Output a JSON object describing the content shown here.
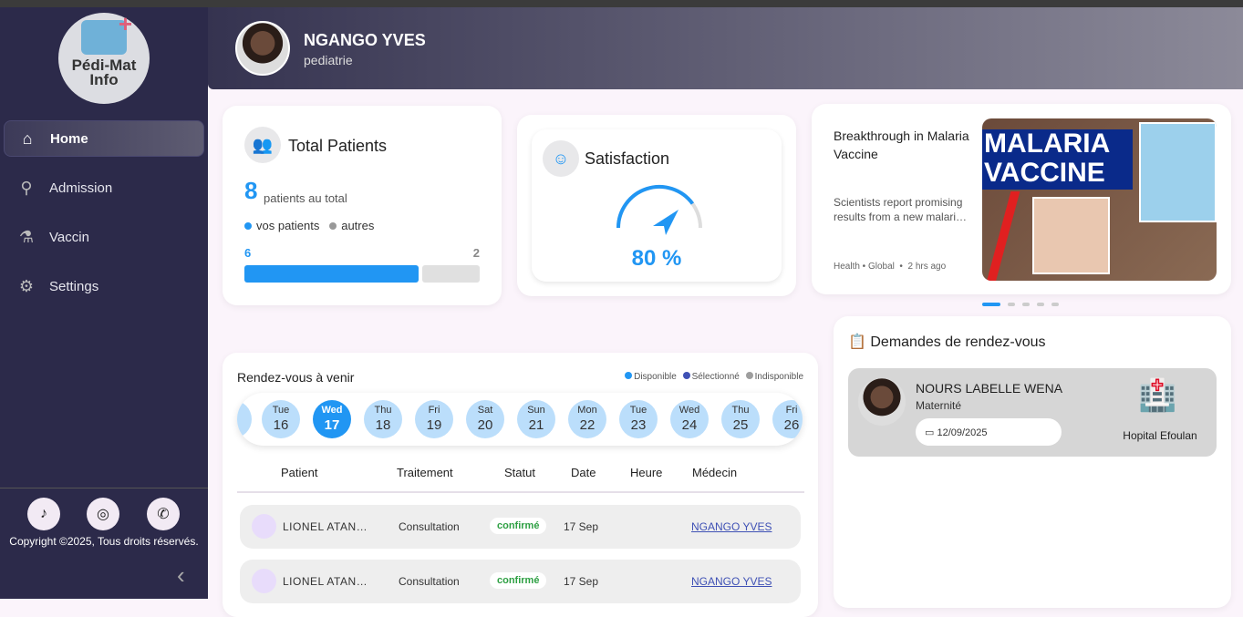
{
  "app": {
    "logo_text": "Pédi-Mat Info"
  },
  "sidebar": {
    "items": [
      {
        "label": "Home",
        "icon": "home-icon"
      },
      {
        "label": "Admission",
        "icon": "search-icon"
      },
      {
        "label": "Vaccin",
        "icon": "vaccine-icon"
      },
      {
        "label": "Settings",
        "icon": "gear-icon"
      }
    ],
    "footer_icons": [
      "music-note-icon",
      "fingerprint-icon",
      "phone-icon"
    ],
    "copyright": "Copyright ©2025, Tous droits réservés."
  },
  "header": {
    "name": "NGANGO YVES",
    "specialty": "pediatrie"
  },
  "total_patients": {
    "title": "Total Patients",
    "count": "8",
    "subtitle": "patients au total",
    "legend_mine": "vos patients",
    "legend_others": "autres",
    "mine": "6",
    "others": "2",
    "colors": {
      "mine": "#2196f3",
      "others": "#e0e0e0"
    }
  },
  "satisfaction": {
    "title": "Satisfaction",
    "value_label": "80 %",
    "value": 80
  },
  "news": {
    "title": "Breakthrough in Malaria Vaccine",
    "summary": "Scientists report promising results from a new malari…",
    "meta": "Health • Global  •  2 hrs ago",
    "image_text_1": "MALARIA",
    "image_text_2": "VACCINE",
    "slides": 5,
    "active_slide": 0
  },
  "appointments": {
    "title": "Rendez-vous à venir",
    "legend": [
      "Disponible",
      "Sélectionné",
      "Indisponible"
    ],
    "days": [
      {
        "d": "Tue",
        "n": "16"
      },
      {
        "d": "Wed",
        "n": "17",
        "selected": true
      },
      {
        "d": "Thu",
        "n": "18"
      },
      {
        "d": "Fri",
        "n": "19"
      },
      {
        "d": "Sat",
        "n": "20"
      },
      {
        "d": "Sun",
        "n": "21"
      },
      {
        "d": "Mon",
        "n": "22"
      },
      {
        "d": "Tue",
        "n": "23"
      },
      {
        "d": "Wed",
        "n": "24"
      },
      {
        "d": "Thu",
        "n": "25"
      },
      {
        "d": "Fri",
        "n": "26"
      }
    ],
    "columns": [
      "Patient",
      "Traitement",
      "Statut",
      "Date",
      "Heure",
      "Médecin"
    ],
    "rows": [
      {
        "patient": "LIONEL ATAN…",
        "treatment": "Consultation",
        "status": "confirmé",
        "date": "17 Sep",
        "time": "",
        "doctor": "NGANGO YVES"
      },
      {
        "patient": "LIONEL ATAN…",
        "treatment": "Consultation",
        "status": "confirmé",
        "date": "17 Sep",
        "time": "",
        "doctor": "NGANGO YVES"
      }
    ]
  },
  "requests": {
    "title": "Demandes de rendez-vous",
    "items": [
      {
        "name": "NOURS LABELLE WENA",
        "department": "Maternité",
        "date": "12/09/2025",
        "hospital": "Hopital Efoulan"
      }
    ]
  }
}
